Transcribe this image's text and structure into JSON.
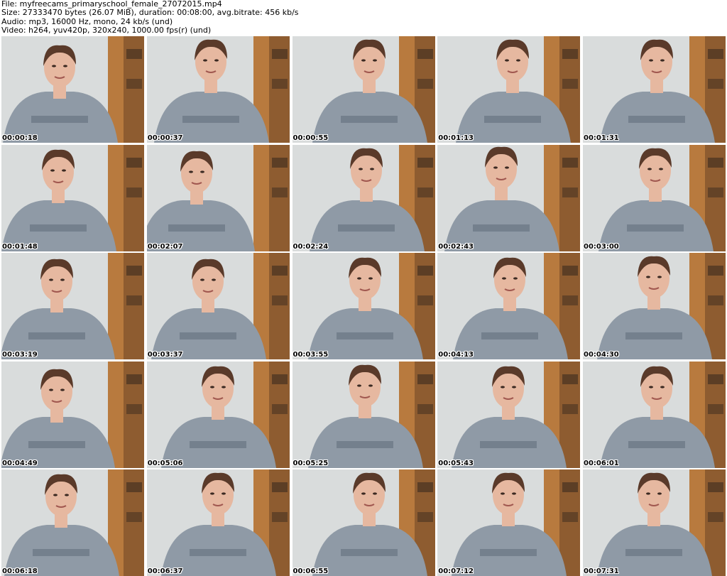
{
  "header": {
    "file_line": "File: myfreecams_primaryschool_female_27072015.mp4",
    "size_line": "Size: 27333470 bytes (26.07 MiB), duration: 00:08:00, avg.bitrate: 456 kb/s",
    "audio_line": "Audio: mp3, 16000 Hz, mono, 24 kb/s (und)",
    "video_line": "Video: h264, yuv420p, 320x240, 1000.00 fps(r) (und)"
  },
  "thumbnails": [
    {
      "timestamp": "00:00:18"
    },
    {
      "timestamp": "00:00:37"
    },
    {
      "timestamp": "00:00:55"
    },
    {
      "timestamp": "00:01:13"
    },
    {
      "timestamp": "00:01:31"
    },
    {
      "timestamp": "00:01:48"
    },
    {
      "timestamp": "00:02:07"
    },
    {
      "timestamp": "00:02:24"
    },
    {
      "timestamp": "00:02:43"
    },
    {
      "timestamp": "00:03:00"
    },
    {
      "timestamp": "00:03:19"
    },
    {
      "timestamp": "00:03:37"
    },
    {
      "timestamp": "00:03:55"
    },
    {
      "timestamp": "00:04:13"
    },
    {
      "timestamp": "00:04:30"
    },
    {
      "timestamp": "00:04:49"
    },
    {
      "timestamp": "00:05:06"
    },
    {
      "timestamp": "00:05:25"
    },
    {
      "timestamp": "00:05:43"
    },
    {
      "timestamp": "00:06:01"
    },
    {
      "timestamp": "00:06:18"
    },
    {
      "timestamp": "00:06:37"
    },
    {
      "timestamp": "00:06:55"
    },
    {
      "timestamp": "00:07:12"
    },
    {
      "timestamp": "00:07:31"
    }
  ],
  "colors": {
    "wall": "#d9dcdc",
    "cabinet": "#b87a3e",
    "cabinet_dark": "#6b4424",
    "shirt": "#8f9aa6",
    "skin": "#e6b8a0",
    "hair": "#5a3a2a"
  }
}
